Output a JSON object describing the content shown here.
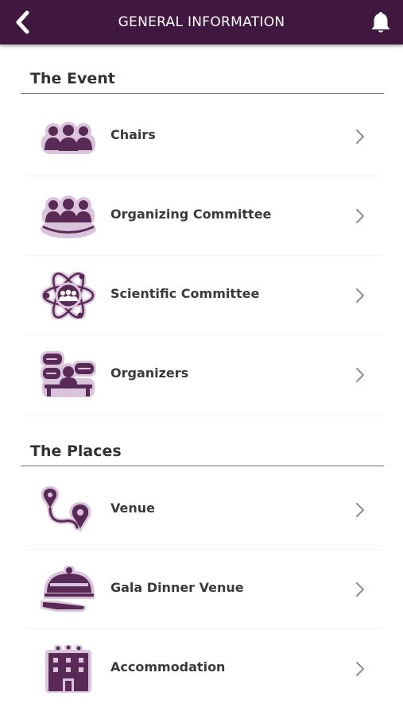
{
  "header": {
    "title": "GENERAL INFORMATION"
  },
  "icons": {
    "back": "chevron-left-icon",
    "notifications": "bell-icon"
  },
  "colors": {
    "topbar": "#40183f",
    "icon_fill": "#5a2a57",
    "icon_glow": "#d9c4dc"
  },
  "sections": [
    {
      "title": "The Event",
      "items": [
        {
          "label": "Chairs",
          "icon": "chairs-group-icon"
        },
        {
          "label": "Organizing Committee",
          "icon": "committee-table-icon"
        },
        {
          "label": "Scientific Committee",
          "icon": "atom-group-icon"
        },
        {
          "label": "Organizers",
          "icon": "speech-bubbles-desk-icon"
        }
      ]
    },
    {
      "title": "The Places",
      "items": [
        {
          "label": "Venue",
          "icon": "map-route-pin-icon"
        },
        {
          "label": "Gala Dinner Venue",
          "icon": "cloche-dinner-icon"
        },
        {
          "label": "Accommodation",
          "icon": "hotel-building-icon"
        }
      ]
    }
  ]
}
